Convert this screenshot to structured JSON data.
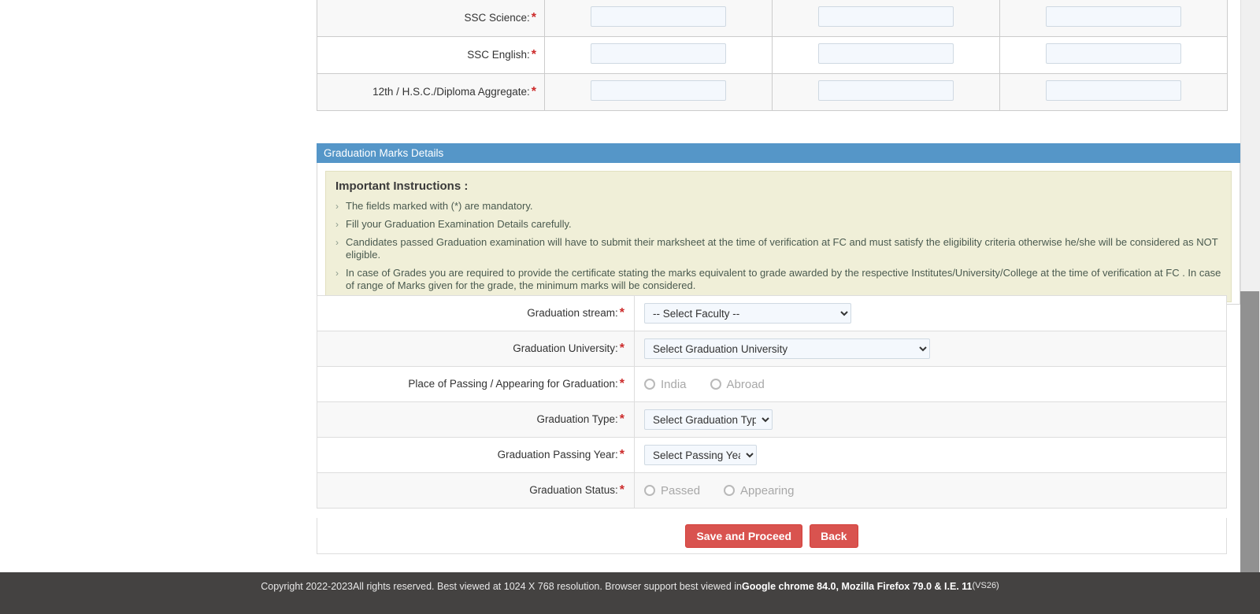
{
  "marks_table": {
    "rows": [
      {
        "label": "SSC Science:",
        "required": "*"
      },
      {
        "label": "SSC English:",
        "required": "*"
      },
      {
        "label": "12th / H.S.C./Diploma Aggregate:",
        "required": "*"
      }
    ]
  },
  "panel": {
    "title": "Graduation Marks Details",
    "instructions": {
      "title": "Important Instructions :",
      "bullet": "›",
      "items": [
        "The fields marked with (*) are mandatory.",
        "Fill your Graduation Examination Details carefully.",
        "Candidates passed Graduation examination will have to submit their marksheet at the time of verification at FC and must satisfy the eligibility criteria otherwise he/she will be considered as NOT eligible.",
        "In case of Grades you are required to provide the certificate stating the marks equivalent to grade awarded by the respective Institutes/University/College at the time of verification at FC . In case of range of Marks given for the grade, the minimum marks will be considered."
      ]
    }
  },
  "form": {
    "required_mark": "*",
    "rows": [
      {
        "label": "Graduation stream:",
        "type": "select",
        "value": "-- Select Faculty --"
      },
      {
        "label": "Graduation University:",
        "type": "select",
        "value": "Select Graduation University"
      },
      {
        "label": "Place of Passing / Appearing for Graduation:",
        "type": "radio",
        "options": [
          "India",
          "Abroad"
        ]
      },
      {
        "label": "Graduation Type:",
        "type": "select",
        "value": "Select Graduation Type"
      },
      {
        "label": "Graduation Passing Year:",
        "type": "select",
        "value": "Select Passing Year"
      },
      {
        "label": "Graduation Status:",
        "type": "radio",
        "options": [
          "Passed",
          "Appearing"
        ]
      }
    ]
  },
  "buttons": {
    "save": "Save and Proceed",
    "back": "Back"
  },
  "footer": {
    "text_1": "Copyright 2022-2023All rights reserved. Best viewed at 1024 X 768 resolution. Browser support best viewed in ",
    "browsers": "Google chrome 84.0, Mozilla Firefox 79.0 & I.E. 11",
    "version": " (VS26)"
  },
  "colors": {
    "panel_header": "#5596c8",
    "instruction_bg": "#f0efd8",
    "button": "#d9534f",
    "footer_bg": "#444241",
    "required": "#cc2a2a"
  }
}
